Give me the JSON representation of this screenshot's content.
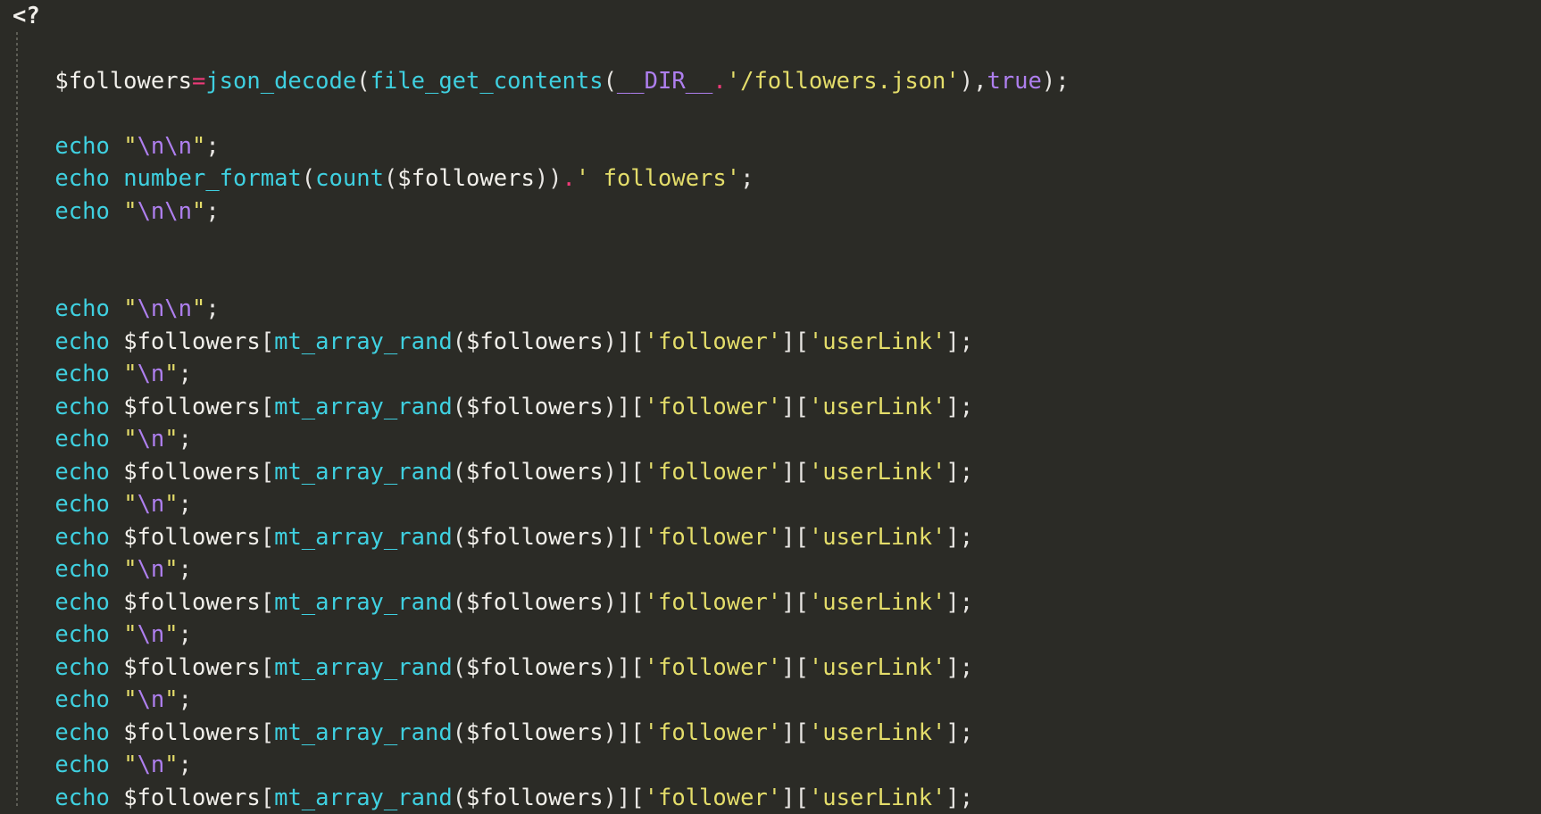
{
  "editor": {
    "language": "php",
    "background_color": "#2b2b26",
    "indent_guide_color": "#5d5d55",
    "colors": {
      "plain": "#e8e6e3",
      "keyword": "#3fd0e0",
      "function": "#3fd0e0",
      "string": "#e4dd6a",
      "escape": "#ae7fee",
      "constant": "#ae7fee",
      "operator": "#ef3a78",
      "variable": "#f2f0eb"
    }
  },
  "code": {
    "open_tag": "<?",
    "lines": [
      {
        "id": "line-1",
        "tokens": []
      },
      {
        "id": "line-2",
        "tokens": [
          {
            "t": "plain",
            "s": "    "
          },
          {
            "t": "var",
            "s": "$followers"
          },
          {
            "t": "op",
            "s": "="
          },
          {
            "t": "fn",
            "s": "json_decode"
          },
          {
            "t": "punct",
            "s": "("
          },
          {
            "t": "fn",
            "s": "file_get_contents"
          },
          {
            "t": "punct",
            "s": "("
          },
          {
            "t": "const",
            "s": "__DIR__"
          },
          {
            "t": "op",
            "s": "."
          },
          {
            "t": "str",
            "s": "'/followers.json'"
          },
          {
            "t": "punct",
            "s": "),"
          },
          {
            "t": "const",
            "s": "true"
          },
          {
            "t": "punct",
            "s": ");"
          }
        ]
      },
      {
        "id": "line-3",
        "tokens": []
      },
      {
        "id": "line-4",
        "tokens": [
          {
            "t": "plain",
            "s": "    "
          },
          {
            "t": "kw",
            "s": "echo"
          },
          {
            "t": "plain",
            "s": " "
          },
          {
            "t": "str",
            "s": "\""
          },
          {
            "t": "esc",
            "s": "\\n\\n"
          },
          {
            "t": "str",
            "s": "\""
          },
          {
            "t": "punct",
            "s": ";"
          }
        ]
      },
      {
        "id": "line-5",
        "tokens": [
          {
            "t": "plain",
            "s": "    "
          },
          {
            "t": "kw",
            "s": "echo"
          },
          {
            "t": "plain",
            "s": " "
          },
          {
            "t": "fn",
            "s": "number_format"
          },
          {
            "t": "punct",
            "s": "("
          },
          {
            "t": "fn",
            "s": "count"
          },
          {
            "t": "punct",
            "s": "("
          },
          {
            "t": "var",
            "s": "$followers"
          },
          {
            "t": "punct",
            "s": "))"
          },
          {
            "t": "op",
            "s": "."
          },
          {
            "t": "str",
            "s": "' followers'"
          },
          {
            "t": "punct",
            "s": ";"
          }
        ]
      },
      {
        "id": "line-6",
        "tokens": [
          {
            "t": "plain",
            "s": "    "
          },
          {
            "t": "kw",
            "s": "echo"
          },
          {
            "t": "plain",
            "s": " "
          },
          {
            "t": "str",
            "s": "\""
          },
          {
            "t": "esc",
            "s": "\\n\\n"
          },
          {
            "t": "str",
            "s": "\""
          },
          {
            "t": "punct",
            "s": ";"
          }
        ]
      },
      {
        "id": "line-7",
        "tokens": []
      },
      {
        "id": "line-8",
        "tokens": []
      },
      {
        "id": "line-9",
        "tokens": [
          {
            "t": "plain",
            "s": "    "
          },
          {
            "t": "kw",
            "s": "echo"
          },
          {
            "t": "plain",
            "s": " "
          },
          {
            "t": "str",
            "s": "\""
          },
          {
            "t": "esc",
            "s": "\\n\\n"
          },
          {
            "t": "str",
            "s": "\""
          },
          {
            "t": "punct",
            "s": ";"
          }
        ]
      },
      {
        "id": "line-10",
        "tokens": [
          {
            "t": "plain",
            "s": "    "
          },
          {
            "t": "kw",
            "s": "echo"
          },
          {
            "t": "plain",
            "s": " "
          },
          {
            "t": "var",
            "s": "$followers"
          },
          {
            "t": "punct",
            "s": "["
          },
          {
            "t": "fn",
            "s": "mt_array_rand"
          },
          {
            "t": "punct",
            "s": "("
          },
          {
            "t": "var",
            "s": "$followers"
          },
          {
            "t": "punct",
            "s": ")]["
          },
          {
            "t": "str",
            "s": "'follower'"
          },
          {
            "t": "punct",
            "s": "]["
          },
          {
            "t": "str",
            "s": "'userLink'"
          },
          {
            "t": "punct",
            "s": "];"
          }
        ]
      },
      {
        "id": "line-11",
        "tokens": [
          {
            "t": "plain",
            "s": "    "
          },
          {
            "t": "kw",
            "s": "echo"
          },
          {
            "t": "plain",
            "s": " "
          },
          {
            "t": "str",
            "s": "\""
          },
          {
            "t": "esc",
            "s": "\\n"
          },
          {
            "t": "str",
            "s": "\""
          },
          {
            "t": "punct",
            "s": ";"
          }
        ]
      },
      {
        "id": "line-12",
        "tokens": [
          {
            "t": "plain",
            "s": "    "
          },
          {
            "t": "kw",
            "s": "echo"
          },
          {
            "t": "plain",
            "s": " "
          },
          {
            "t": "var",
            "s": "$followers"
          },
          {
            "t": "punct",
            "s": "["
          },
          {
            "t": "fn",
            "s": "mt_array_rand"
          },
          {
            "t": "punct",
            "s": "("
          },
          {
            "t": "var",
            "s": "$followers"
          },
          {
            "t": "punct",
            "s": ")]["
          },
          {
            "t": "str",
            "s": "'follower'"
          },
          {
            "t": "punct",
            "s": "]["
          },
          {
            "t": "str",
            "s": "'userLink'"
          },
          {
            "t": "punct",
            "s": "];"
          }
        ]
      },
      {
        "id": "line-13",
        "tokens": [
          {
            "t": "plain",
            "s": "    "
          },
          {
            "t": "kw",
            "s": "echo"
          },
          {
            "t": "plain",
            "s": " "
          },
          {
            "t": "str",
            "s": "\""
          },
          {
            "t": "esc",
            "s": "\\n"
          },
          {
            "t": "str",
            "s": "\""
          },
          {
            "t": "punct",
            "s": ";"
          }
        ]
      },
      {
        "id": "line-14",
        "tokens": [
          {
            "t": "plain",
            "s": "    "
          },
          {
            "t": "kw",
            "s": "echo"
          },
          {
            "t": "plain",
            "s": " "
          },
          {
            "t": "var",
            "s": "$followers"
          },
          {
            "t": "punct",
            "s": "["
          },
          {
            "t": "fn",
            "s": "mt_array_rand"
          },
          {
            "t": "punct",
            "s": "("
          },
          {
            "t": "var",
            "s": "$followers"
          },
          {
            "t": "punct",
            "s": ")]["
          },
          {
            "t": "str",
            "s": "'follower'"
          },
          {
            "t": "punct",
            "s": "]["
          },
          {
            "t": "str",
            "s": "'userLink'"
          },
          {
            "t": "punct",
            "s": "];"
          }
        ]
      },
      {
        "id": "line-15",
        "tokens": [
          {
            "t": "plain",
            "s": "    "
          },
          {
            "t": "kw",
            "s": "echo"
          },
          {
            "t": "plain",
            "s": " "
          },
          {
            "t": "str",
            "s": "\""
          },
          {
            "t": "esc",
            "s": "\\n"
          },
          {
            "t": "str",
            "s": "\""
          },
          {
            "t": "punct",
            "s": ";"
          }
        ]
      },
      {
        "id": "line-16",
        "tokens": [
          {
            "t": "plain",
            "s": "    "
          },
          {
            "t": "kw",
            "s": "echo"
          },
          {
            "t": "plain",
            "s": " "
          },
          {
            "t": "var",
            "s": "$followers"
          },
          {
            "t": "punct",
            "s": "["
          },
          {
            "t": "fn",
            "s": "mt_array_rand"
          },
          {
            "t": "punct",
            "s": "("
          },
          {
            "t": "var",
            "s": "$followers"
          },
          {
            "t": "punct",
            "s": ")]["
          },
          {
            "t": "str",
            "s": "'follower'"
          },
          {
            "t": "punct",
            "s": "]["
          },
          {
            "t": "str",
            "s": "'userLink'"
          },
          {
            "t": "punct",
            "s": "];"
          }
        ]
      },
      {
        "id": "line-17",
        "tokens": [
          {
            "t": "plain",
            "s": "    "
          },
          {
            "t": "kw",
            "s": "echo"
          },
          {
            "t": "plain",
            "s": " "
          },
          {
            "t": "str",
            "s": "\""
          },
          {
            "t": "esc",
            "s": "\\n"
          },
          {
            "t": "str",
            "s": "\""
          },
          {
            "t": "punct",
            "s": ";"
          }
        ]
      },
      {
        "id": "line-18",
        "tokens": [
          {
            "t": "plain",
            "s": "    "
          },
          {
            "t": "kw",
            "s": "echo"
          },
          {
            "t": "plain",
            "s": " "
          },
          {
            "t": "var",
            "s": "$followers"
          },
          {
            "t": "punct",
            "s": "["
          },
          {
            "t": "fn",
            "s": "mt_array_rand"
          },
          {
            "t": "punct",
            "s": "("
          },
          {
            "t": "var",
            "s": "$followers"
          },
          {
            "t": "punct",
            "s": ")]["
          },
          {
            "t": "str",
            "s": "'follower'"
          },
          {
            "t": "punct",
            "s": "]["
          },
          {
            "t": "str",
            "s": "'userLink'"
          },
          {
            "t": "punct",
            "s": "];"
          }
        ]
      },
      {
        "id": "line-19",
        "tokens": [
          {
            "t": "plain",
            "s": "    "
          },
          {
            "t": "kw",
            "s": "echo"
          },
          {
            "t": "plain",
            "s": " "
          },
          {
            "t": "str",
            "s": "\""
          },
          {
            "t": "esc",
            "s": "\\n"
          },
          {
            "t": "str",
            "s": "\""
          },
          {
            "t": "punct",
            "s": ";"
          }
        ]
      },
      {
        "id": "line-20",
        "tokens": [
          {
            "t": "plain",
            "s": "    "
          },
          {
            "t": "kw",
            "s": "echo"
          },
          {
            "t": "plain",
            "s": " "
          },
          {
            "t": "var",
            "s": "$followers"
          },
          {
            "t": "punct",
            "s": "["
          },
          {
            "t": "fn",
            "s": "mt_array_rand"
          },
          {
            "t": "punct",
            "s": "("
          },
          {
            "t": "var",
            "s": "$followers"
          },
          {
            "t": "punct",
            "s": ")]["
          },
          {
            "t": "str",
            "s": "'follower'"
          },
          {
            "t": "punct",
            "s": "]["
          },
          {
            "t": "str",
            "s": "'userLink'"
          },
          {
            "t": "punct",
            "s": "];"
          }
        ]
      },
      {
        "id": "line-21",
        "tokens": [
          {
            "t": "plain",
            "s": "    "
          },
          {
            "t": "kw",
            "s": "echo"
          },
          {
            "t": "plain",
            "s": " "
          },
          {
            "t": "str",
            "s": "\""
          },
          {
            "t": "esc",
            "s": "\\n"
          },
          {
            "t": "str",
            "s": "\""
          },
          {
            "t": "punct",
            "s": ";"
          }
        ]
      },
      {
        "id": "line-22",
        "tokens": [
          {
            "t": "plain",
            "s": "    "
          },
          {
            "t": "kw",
            "s": "echo"
          },
          {
            "t": "plain",
            "s": " "
          },
          {
            "t": "var",
            "s": "$followers"
          },
          {
            "t": "punct",
            "s": "["
          },
          {
            "t": "fn",
            "s": "mt_array_rand"
          },
          {
            "t": "punct",
            "s": "("
          },
          {
            "t": "var",
            "s": "$followers"
          },
          {
            "t": "punct",
            "s": ")]["
          },
          {
            "t": "str",
            "s": "'follower'"
          },
          {
            "t": "punct",
            "s": "]["
          },
          {
            "t": "str",
            "s": "'userLink'"
          },
          {
            "t": "punct",
            "s": "];"
          }
        ]
      },
      {
        "id": "line-23",
        "tokens": [
          {
            "t": "plain",
            "s": "    "
          },
          {
            "t": "kw",
            "s": "echo"
          },
          {
            "t": "plain",
            "s": " "
          },
          {
            "t": "str",
            "s": "\""
          },
          {
            "t": "esc",
            "s": "\\n"
          },
          {
            "t": "str",
            "s": "\""
          },
          {
            "t": "punct",
            "s": ";"
          }
        ]
      },
      {
        "id": "line-24",
        "tokens": [
          {
            "t": "plain",
            "s": "    "
          },
          {
            "t": "kw",
            "s": "echo"
          },
          {
            "t": "plain",
            "s": " "
          },
          {
            "t": "var",
            "s": "$followers"
          },
          {
            "t": "punct",
            "s": "["
          },
          {
            "t": "fn",
            "s": "mt_array_rand"
          },
          {
            "t": "punct",
            "s": "("
          },
          {
            "t": "var",
            "s": "$followers"
          },
          {
            "t": "punct",
            "s": ")]["
          },
          {
            "t": "str",
            "s": "'follower'"
          },
          {
            "t": "punct",
            "s": "]["
          },
          {
            "t": "str",
            "s": "'userLink'"
          },
          {
            "t": "punct",
            "s": "];"
          }
        ]
      }
    ]
  }
}
